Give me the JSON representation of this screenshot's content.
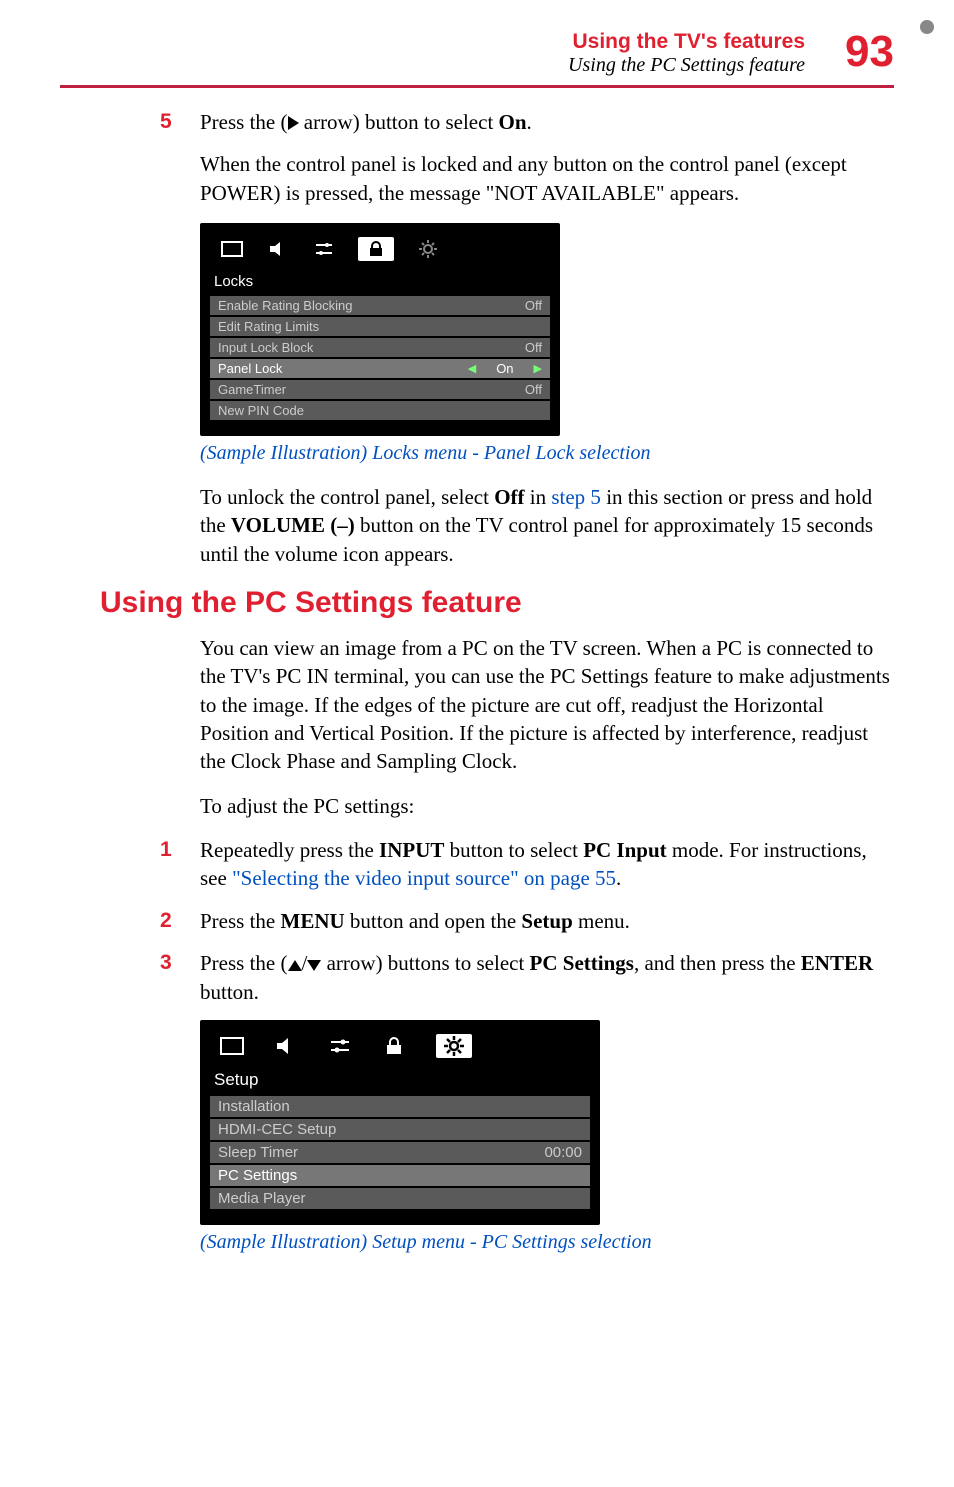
{
  "header": {
    "title": "Using the TV's features",
    "subtitle": "Using the PC Settings feature",
    "page_number": "93"
  },
  "step5": {
    "num": "5",
    "pre": "Press the (",
    "post": " arrow) button to select ",
    "bold": "On",
    "end": "."
  },
  "locked_msg": "When the control panel is locked and any button on the control panel (except POWER) is pressed, the message \"NOT AVAILABLE\" appears.",
  "locks_menu": {
    "title": "Locks",
    "rows": [
      {
        "label": "Enable Rating Blocking",
        "value": "Off"
      },
      {
        "label": "Edit Rating Limits",
        "value": ""
      },
      {
        "label": "Input Lock Block",
        "value": "Off"
      },
      {
        "label": "Panel Lock",
        "value": "On",
        "sel": true
      },
      {
        "label": "GameTimer",
        "value": "Off"
      },
      {
        "label": "New PIN Code",
        "value": ""
      }
    ]
  },
  "caption1": "(Sample Illustration) Locks menu - Panel Lock selection",
  "unlock_para": {
    "t1": "To unlock the control panel, select ",
    "b1": "Off",
    "t2": " in ",
    "link": "step 5",
    "t3": " in this section or press and hold the ",
    "b2": "VOLUME (–)",
    "t4": " button on the TV control panel for approximately 15 seconds until the volume icon appears."
  },
  "section_heading": "Using the PC Settings feature",
  "pc_intro": "You can view an image from a PC on the TV screen. When a PC is connected to the TV's PC IN terminal, you can use the PC Settings feature to make adjustments to the image. If the edges of the picture are cut off, readjust the Horizontal Position and Vertical Position. If the picture is affected by interference, readjust the Clock Phase and Sampling Clock.",
  "pc_lead": "To adjust the PC settings:",
  "pc_step1": {
    "num": "1",
    "t1": "Repeatedly press the ",
    "b1": "INPUT",
    "t2": " button to select ",
    "b2": "PC Input",
    "t3": " mode. For instructions, see ",
    "link": "\"Selecting the video input source\" on page 55",
    "t4": "."
  },
  "pc_step2": {
    "num": "2",
    "t1": "Press the ",
    "b1": "MENU",
    "t2": " button and open the ",
    "b2": "Setup",
    "t3": " menu."
  },
  "pc_step3": {
    "num": "3",
    "t1": "Press the (",
    "t2": " arrow) buttons to select ",
    "b1": "PC Settings",
    "t3": ", and then press the ",
    "b2": "ENTER",
    "t4": " button."
  },
  "setup_menu": {
    "title": "Setup",
    "rows": [
      {
        "label": "Installation",
        "value": ""
      },
      {
        "label": "HDMI-CEC Setup",
        "value": ""
      },
      {
        "label": "Sleep Timer",
        "value": "00:00"
      },
      {
        "label": "PC Settings",
        "value": "",
        "sel": true
      },
      {
        "label": "Media Player",
        "value": ""
      }
    ]
  },
  "caption2": "(Sample Illustration) Setup menu - PC Settings selection"
}
